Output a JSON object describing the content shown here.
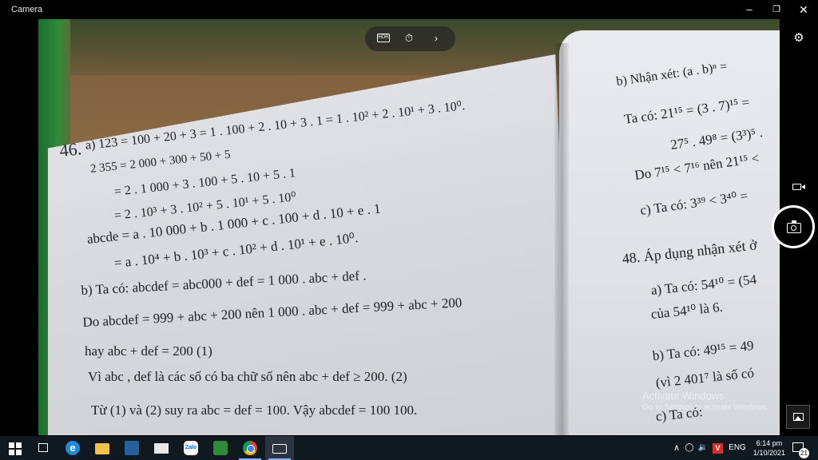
{
  "window": {
    "title": "Camera",
    "minimize_glyph": "–",
    "restore_glyph": "❐",
    "close_glyph": "✕"
  },
  "camera_controls": {
    "hdr_label": "HDR",
    "timer_glyph": "⏱",
    "chevron_glyph": "›",
    "settings_glyph": "⚙"
  },
  "page_left": {
    "lines": [
      "a) 123 = 100 + 20 + 3 = 1 . 100 + 2 . 10 + 3 . 1 = 1 . 10² + 2 . 10¹ + 3 . 10⁰.",
      "2 355 = 2 000 + 300 + 50 + 5",
      "= 2 . 1 000 + 3 . 100 + 5 . 10 + 5 . 1",
      "= 2 . 10³ + 3 . 10² + 5 . 10¹ + 5 . 10⁰",
      "abcde = a . 10 000 + b . 1 000 + c . 100 + d . 10 + e . 1",
      "= a . 10⁴ + b . 10³ + c . 10² + d . 10¹ + e . 10⁰.",
      "b) Ta có: abcdef = abc000 + def = 1 000 . abc + def .",
      "Do abcdef = 999 + abc + 200 nên 1 000 . abc + def = 999 + abc + 200",
      "hay abc + def = 200   (1)",
      "Vì abc , def là các số có ba chữ số nên abc + def ≥ 200.     (2)",
      "Từ (1) và (2) suy ra abc = def = 100. Vậy abcdef = 100 100."
    ],
    "exercise_mark": "46."
  },
  "page_right": {
    "lines": [
      "b) Nhận xét: (a . b)ⁿ =",
      "Ta có: 21¹⁵ = (3 . 7)¹⁵ =",
      "27⁵ . 49⁸ = (3³)⁵ .",
      "Do 7¹⁵ < 7¹⁶ nên 21¹⁵ <",
      "c) Ta có: 3³⁹ < 3⁴⁰ =",
      "48. Áp dụng nhận xét ở",
      "a) Ta có: 54¹⁰ = (54",
      "của 54¹⁰ là 6.",
      "b) Ta có: 49¹⁵ = 49",
      "(vì 2 401⁷ là số có",
      "c) Ta có:"
    ]
  },
  "watermark": {
    "title": "Activate Windows",
    "subtitle": "Go to Settings to activate Windows."
  },
  "taskbar": {
    "edge_glyph": "e",
    "zalo_label": "Zalo",
    "tray_chevron": "∧",
    "tray_volume": "🔉",
    "tray_v": "V",
    "language": "ENG",
    "time": "6:14 pm",
    "date": "1/10/2021",
    "notification_count": "21"
  }
}
